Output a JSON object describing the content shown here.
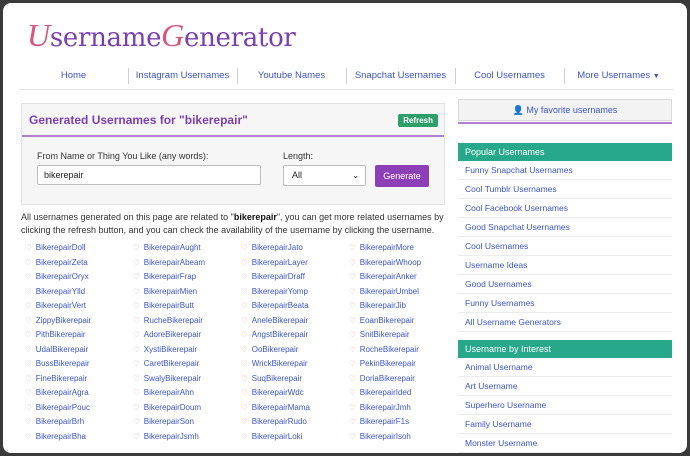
{
  "brand": {
    "u": "U",
    "mid": "sername",
    "g": "G",
    "end": "enerator"
  },
  "nav": {
    "items": [
      "Home",
      "Instagram Usernames",
      "Youtube Names",
      "Snapchat Usernames",
      "Cool Usernames",
      "More Usernames"
    ]
  },
  "generator": {
    "title": "Generated Usernames for \"bikerepair\"",
    "refresh_label": "Refresh",
    "name_label": "From Name or Thing You Like (any words):",
    "name_value": "bikerepair",
    "length_label": "Length:",
    "length_value": "All",
    "button_label": "Generate"
  },
  "description": {
    "pre": "All usernames generated on this page are related to \"",
    "keyword": "bikerepair",
    "post": "\", you can get more related usernames by clicking the refresh button, and you can check the availability of the username by clicking the username."
  },
  "usernames": [
    [
      "BikerepairDoll",
      "BikerepairZeta",
      "BikerepairOryx",
      "BikerepairYlld",
      "BikerepairVert",
      "ZippyBikerepair",
      "PithBikerepair",
      "UdalBikerepair",
      "BussBikerepair",
      "FineBikerepair",
      "BikerepairAgra",
      "BikerepairPouc",
      "BikerepairBrh",
      "BikerepairBha"
    ],
    [
      "BikerepairAught",
      "BikerepairAbeam",
      "BikerepairFrap",
      "BikerepairMien",
      "BikerepairButt",
      "RucheBikerepair",
      "AdoreBikerepair",
      "XystiBikerepair",
      "CaretBikerepair",
      "SwalyBikerepair",
      "BikerepairAhn",
      "BikerepairDoum",
      "BikerepairSon",
      "BikerepairJsmh"
    ],
    [
      "BikerepairJato",
      "BikerepairLayer",
      "BikerepairDraff",
      "BikerepairYomp",
      "BikerepairBeata",
      "AneleBikerepair",
      "AngstBikerepair",
      "OoBikerepair",
      "WrickBikerepair",
      "SuqBikerepair",
      "BikerepairWdc",
      "BikerepairMama",
      "BikerepairRudo",
      "BikerepairLoki"
    ],
    [
      "BikerepairMore",
      "BikerepairWhoop",
      "BikerepairAnker",
      "BikerepairUmbel",
      "BikerepairJib",
      "EoanBikerepair",
      "SnitBikerepair",
      "RocheBikerepair",
      "PekinBikerepair",
      "DoriaBikerepair",
      "BikerepairIded",
      "BikerepairJmh",
      "BikerepairF1s",
      "BikerepairIsoh"
    ]
  ],
  "sidebar": {
    "favorites": "My favorite usernames",
    "popular_title": "Popular Usernames",
    "popular": [
      "Funny Snapchat Usernames",
      "Cool Tumblr Usernames",
      "Cool Facebook Usernames",
      "Good Snapchat Usernames",
      "Cool Usernames",
      "Username Ideas",
      "Good Usernames",
      "Funny Usernames",
      "All Username Generators"
    ],
    "interest_title": "Username by Interest",
    "interest": [
      "Animal Username",
      "Art Username",
      "Superhero Username",
      "Family Username",
      "Monster Username"
    ]
  },
  "colors": {
    "accent": "#8d3fb8",
    "link": "#3b55c8",
    "section": "#27a88a",
    "refresh": "#2e9f6b"
  }
}
